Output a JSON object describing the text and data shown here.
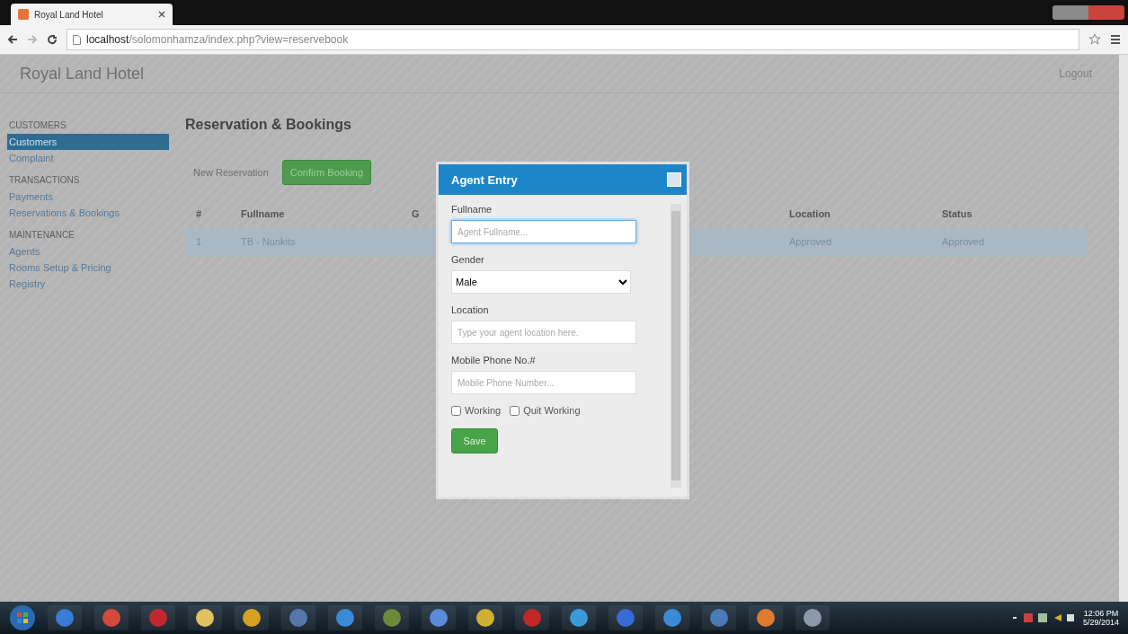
{
  "browser": {
    "tab_title": "Royal Land Hotel",
    "url_host": "localhost",
    "url_path": "/solomonhamza/index.php?view=reservebook"
  },
  "app": {
    "brand": "Royal Land Hotel",
    "logout": "Logout"
  },
  "sidebar": {
    "sections": [
      {
        "heading": "CUSTOMERS",
        "items": [
          {
            "label": "Customers",
            "selected": true
          },
          {
            "label": "Complaint",
            "selected": false
          }
        ]
      },
      {
        "heading": "TRANSACTIONS",
        "items": [
          {
            "label": "Payments",
            "selected": false
          },
          {
            "label": "Reservations & Bookings",
            "selected": false
          }
        ]
      },
      {
        "heading": "MAINTENANCE",
        "items": [
          {
            "label": "Agents",
            "selected": false
          },
          {
            "label": "Rooms Setup & Pricing",
            "selected": false
          },
          {
            "label": "Registry",
            "selected": false
          }
        ]
      }
    ]
  },
  "main": {
    "title": "Reservation & Bookings",
    "buttons": [
      {
        "label": "New Reservation",
        "kind": "plain"
      },
      {
        "label": "Confirm Booking",
        "kind": "success"
      }
    ],
    "table": {
      "columns": [
        "#",
        "Fullname",
        "G",
        "Location",
        "Status"
      ],
      "rows": [
        {
          "cells": [
            "1",
            "TB - Nunkits",
            "",
            "Approved",
            "Approved"
          ],
          "selected": true
        }
      ]
    }
  },
  "modal": {
    "title": "Agent Entry",
    "fields": [
      {
        "label": "Fullname",
        "kind": "input",
        "placeholder": "Agent Fullname...",
        "focused": true
      },
      {
        "label": "Gender",
        "kind": "select",
        "value": "Male"
      },
      {
        "label": "Location",
        "kind": "input",
        "placeholder": "Type your agent location here.",
        "focused": false
      },
      {
        "label": "Mobile Phone No.#",
        "kind": "input",
        "placeholder": "Mobile Phone Number...",
        "focused": false
      }
    ],
    "checkboxes": [
      {
        "label": "Working",
        "checked": false
      },
      {
        "label": "Quit Working",
        "checked": false
      }
    ],
    "save": "Save"
  },
  "taskbar": {
    "time": "12:06 PM",
    "date": "5/29/2014"
  }
}
